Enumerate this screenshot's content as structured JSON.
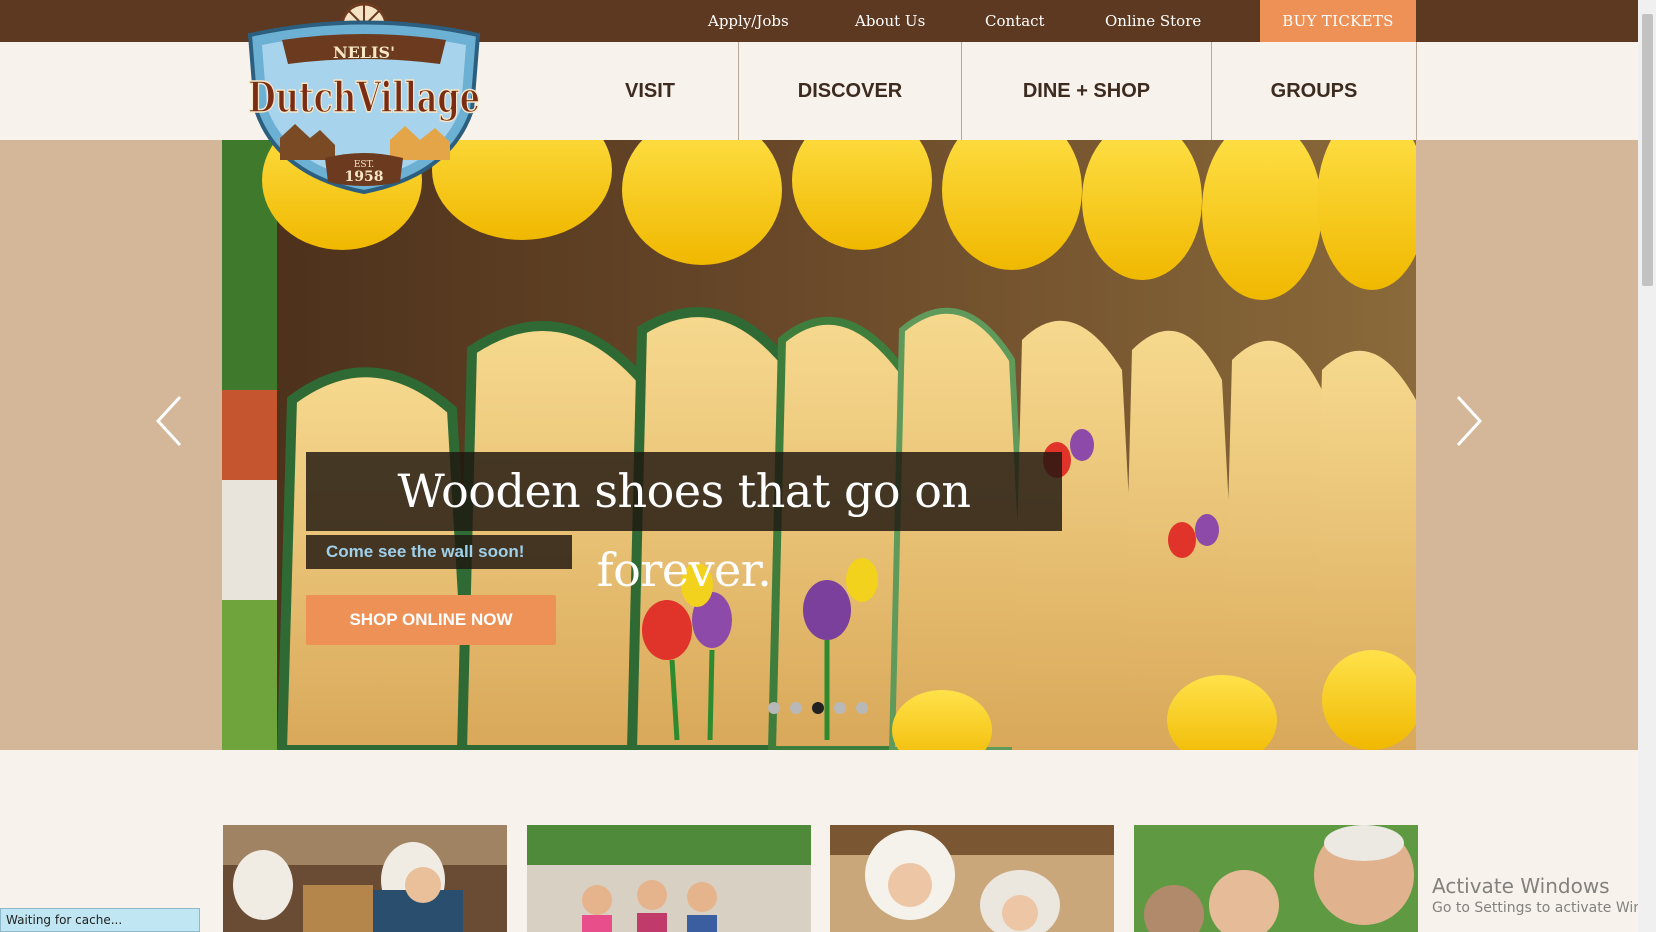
{
  "header": {
    "top_links": [
      "Apply/Jobs",
      "About Us",
      "Contact",
      "Online Store"
    ],
    "buy_tickets": "BUY TICKETS",
    "nav": [
      "VISIT",
      "DISCOVER",
      "DINE + SHOP",
      "GROUPS"
    ]
  },
  "logo": {
    "top_text": "NELIS'",
    "name": "DutchVillage",
    "est": "EST.",
    "year": "1958"
  },
  "hero": {
    "title": "Wooden shoes that go on forever.",
    "subtitle": "Come see the wall soon!",
    "button": "SHOP ONLINE NOW",
    "slide_count": 5,
    "active_slide": 3
  },
  "status": {
    "text": "Waiting for cache..."
  },
  "watermark": {
    "line1": "Activate Windows",
    "line2": "Go to Settings to activate Windows."
  },
  "colors": {
    "topbar": "#5c3920",
    "accent": "#ed9157",
    "page_bg": "#f7f3ec",
    "hero_band": "#d4b699",
    "nav_text": "#3d2b1f",
    "subtitle": "#9fd0ea"
  },
  "icons": {
    "prev": "chevron-left-icon",
    "next": "chevron-right-icon"
  }
}
